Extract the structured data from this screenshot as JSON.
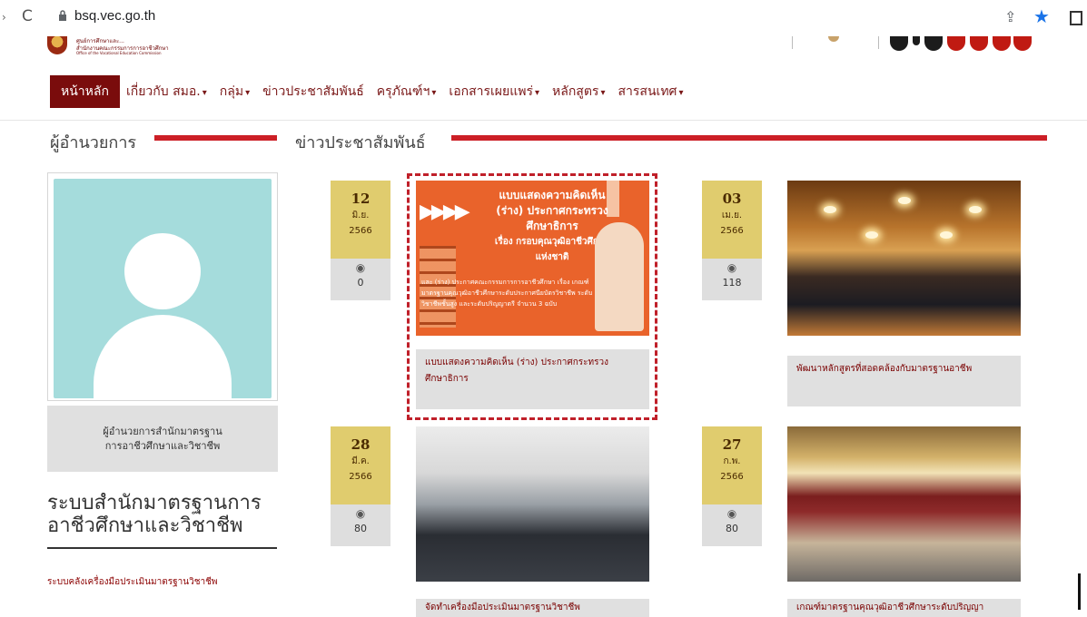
{
  "browser": {
    "url": "bsq.vec.go.th",
    "icons": [
      "reload-icon",
      "lock-icon",
      "share-icon",
      "bookmark-star-icon",
      "extension-icon"
    ]
  },
  "header": {
    "logo_line1": "ศูนย์การศึกษาและ...",
    "logo_line2": "สำนักงานคณะกรรมการการอาชีวศึกษา",
    "logo_line3": "Office of the Vocational Education Commission"
  },
  "menu": {
    "items": [
      {
        "label": "หน้าหลัก",
        "active": true,
        "dropdown": false
      },
      {
        "label": "เกี่ยวกับ สมอ.",
        "active": false,
        "dropdown": true
      },
      {
        "label": "กลุ่ม",
        "active": false,
        "dropdown": true
      },
      {
        "label": "ข่าวประชาสัมพันธ์",
        "active": false,
        "dropdown": false
      },
      {
        "label": "ครุภัณฑ์ฯ",
        "active": false,
        "dropdown": true
      },
      {
        "label": "เอกสารเผยแพร่",
        "active": false,
        "dropdown": true
      },
      {
        "label": "หลักสูตร",
        "active": false,
        "dropdown": true
      },
      {
        "label": "สารสนเทศ",
        "active": false,
        "dropdown": true
      }
    ],
    "caret": "▾"
  },
  "sidebar": {
    "heading": "ผู้อำนวยการ",
    "director_caption_line1": "ผู้อำนวยการสำนักมาตรฐาน",
    "director_caption_line2": "การอาชีวศึกษาและวิชาชีพ",
    "system_title_line1": "ระบบสำนักมาตรฐานการ",
    "system_title_line2": "อาชีวศึกษาและวิชาชีพ",
    "link": "ระบบคลังเครื่องมือประเมินมาตรฐานวิชาชีพ"
  },
  "news": {
    "heading": "ข่าวประชาสัมพันธ์",
    "eye_glyph": "◉",
    "items": [
      {
        "day": "12",
        "month": "มิ.ย.",
        "year": "2566",
        "views": "0",
        "caption": "แบบแสดงความคิดเห็น (ร่าง) ประกาศกระทรวงศึกษาธิการ"
      },
      {
        "day": "03",
        "month": "เม.ย.",
        "year": "2566",
        "views": "118",
        "caption": "พัฒนาหลักสูตรที่สอดคล้องกับมาตรฐานอาชีพ"
      },
      {
        "day": "28",
        "month": "มี.ค.",
        "year": "2566",
        "views": "80",
        "caption": "จัดทำเครื่องมือประเมินมาตรฐานวิชาชีพ"
      },
      {
        "day": "27",
        "month": "ก.พ.",
        "year": "2566",
        "views": "80",
        "caption": "เกณฑ์มาตรฐานคุณวุฒิอาชีวศึกษาระดับปริญญา"
      }
    ],
    "poster": {
      "title_line1": "แบบแสดงความคิดเห็น",
      "title_line2": "(ร่าง) ประกาศกระทรวงศึกษาธิการ",
      "title_line3": "เรื่อง กรอบคุณวุฒิอาชีวศึกษาแห่งชาติ",
      "body": "และ (ร่าง) ประกาศคณะกรรมการการอาชีวศึกษา เรื่อง เกณฑ์มาตรฐานคุณวุฒิอาชีวศึกษาระดับประกาศนียบัตรวิชาชีพ ระดับวิชาชีพชั้นสูง และระดับปริญญาตรี จำนวน 3 ฉบับ",
      "arrows": "▶▶▶▶"
    }
  },
  "colors": {
    "accent": "#7a0c0c",
    "section_bar": "#cc1f26",
    "date_gold": "#e0cc6e",
    "avatar_bg": "#a5dcdc",
    "highlight": "#c0202a"
  }
}
